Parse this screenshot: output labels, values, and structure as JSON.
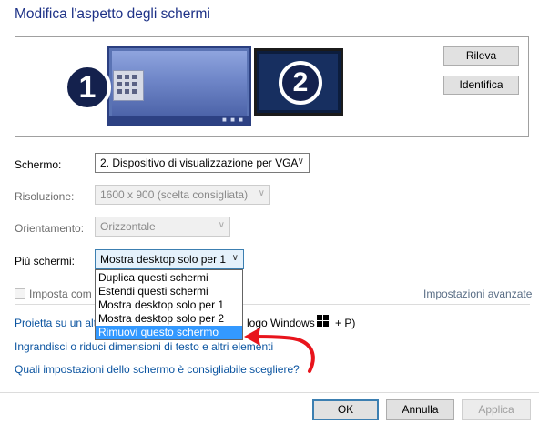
{
  "page": {
    "title": "Modifica l'aspetto degli schermi"
  },
  "preview": {
    "monitor1_number": "1",
    "monitor2_number": "2",
    "detect_button": "Rileva",
    "identify_button": "Identifica"
  },
  "display": {
    "label": "Schermo:",
    "value": "2. Dispositivo di visualizzazione per VGA"
  },
  "resolution": {
    "label": "Risoluzione:",
    "value": "1600 x 900 (scelta consigliata)"
  },
  "orientation": {
    "label": "Orientamento:",
    "value": "Orizzontale"
  },
  "multiple": {
    "label": "Più schermi:",
    "value": "Mostra desktop solo per 1",
    "options": [
      "Duplica questi schermi",
      "Estendi questi schermi",
      "Mostra desktop solo per 1",
      "Mostra desktop solo per 2",
      "Rimuovi questo schermo"
    ],
    "selected_option": "Rimuovi questo schermo"
  },
  "checkbox": {
    "label_visible": "Imposta com"
  },
  "advanced_link": "Impostazioni avanzate",
  "links": {
    "project_prefix": "Proietta su un alt",
    "project_suffix": "logo Windows",
    "project_key": "+ P)",
    "resize_text": "Ingrandisci o riduci dimensioni di testo e altri elementi",
    "which_settings": "Quali impostazioni dello schermo è consigliabile scegliere?"
  },
  "footer": {
    "ok": "OK",
    "cancel": "Annulla",
    "apply": "Applica"
  },
  "colors": {
    "title": "#1e3287",
    "link": "#0b54a0",
    "selection": "#3399ff",
    "annotation_arrow": "#e8141c"
  },
  "icons": {
    "dropdown": "chevron-down-icon",
    "windows": "windows-logo-icon",
    "annotation": "red-arrow-annotation"
  }
}
